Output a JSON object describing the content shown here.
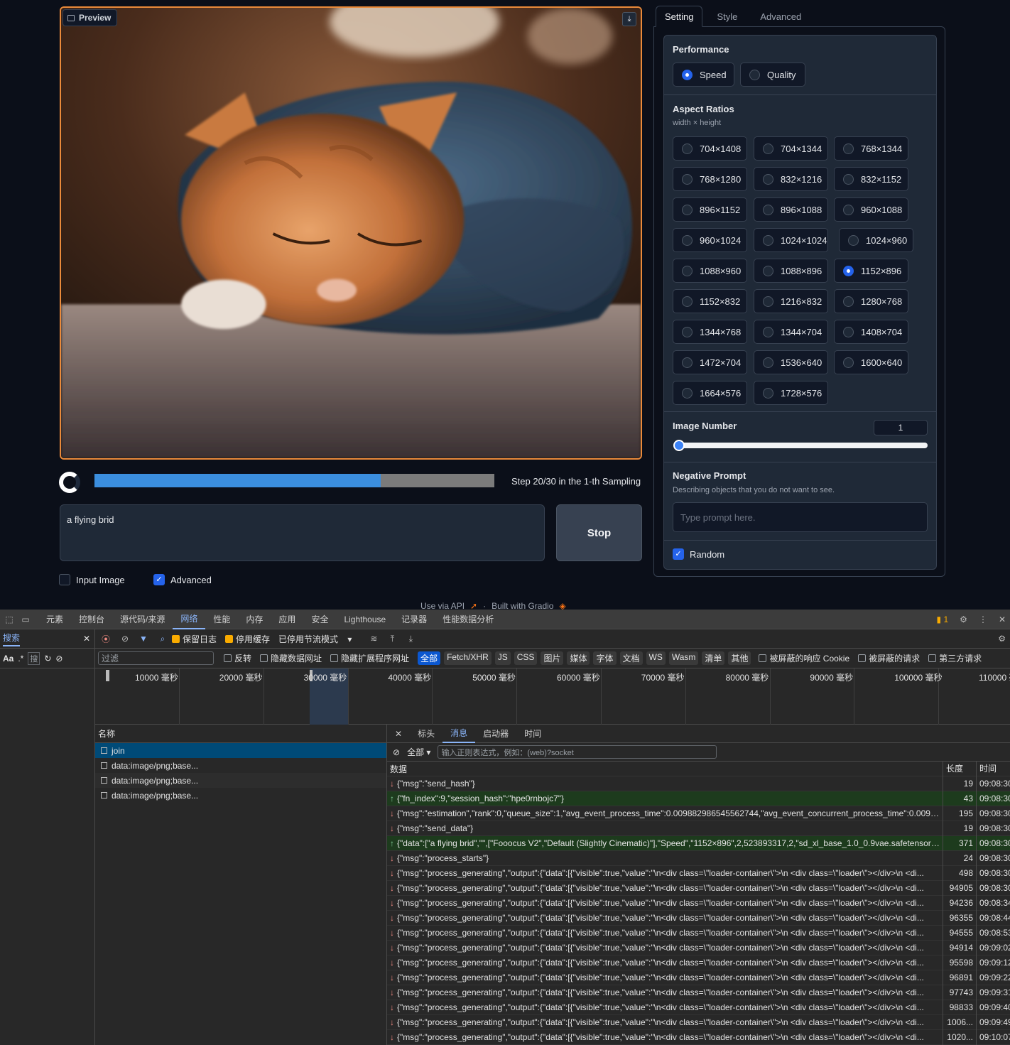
{
  "preview": {
    "label": "Preview"
  },
  "progress": {
    "fraction": 0.715,
    "step_text": "Step 20/30 in the 1-th Sampling"
  },
  "prompt": {
    "value": "a flying brid"
  },
  "stop_button": {
    "label": "Stop"
  },
  "checks": {
    "input_image": "Input Image",
    "advanced": "Advanced"
  },
  "footer": {
    "api": "Use via API",
    "sep": "·",
    "built": "Built with Gradio"
  },
  "tabs": [
    "Setting",
    "Style",
    "Advanced"
  ],
  "performance": {
    "title": "Performance",
    "options": [
      "Speed",
      "Quality"
    ],
    "selected": "Speed"
  },
  "aspect": {
    "title": "Aspect Ratios",
    "subtitle": "width × height",
    "options": [
      "704×1408",
      "704×1344",
      "768×1344",
      "768×1280",
      "832×1216",
      "832×1152",
      "896×1152",
      "896×1088",
      "960×1088",
      "960×1024",
      "1024×1024",
      "1024×960",
      "1088×960",
      "1088×896",
      "1152×896",
      "1152×832",
      "1216×832",
      "1280×768",
      "1344×768",
      "1344×704",
      "1408×704",
      "1472×704",
      "1536×640",
      "1600×640",
      "1664×576",
      "1728×576"
    ],
    "selected": "1152×896"
  },
  "image_number": {
    "title": "Image Number",
    "value": "1"
  },
  "negative": {
    "title": "Negative Prompt",
    "subtitle": "Describing objects that you do not want to see.",
    "placeholder": "Type prompt here."
  },
  "random": {
    "label": "Random"
  },
  "devtools": {
    "tabs": [
      "元素",
      "控制台",
      "源代码/来源",
      "网络",
      "性能",
      "内存",
      "应用",
      "安全",
      "Lighthouse",
      "记录器",
      "性能数据分析"
    ],
    "active_tab": "网络",
    "issues_count": "1",
    "search_label": "搜索",
    "aa": "Aa",
    "dot_star": ".*",
    "search_box": "搜",
    "toolbar": {
      "preserve_log": "保留日志",
      "disable_cache": "停用缓存",
      "throttle": "已停用节流模式"
    },
    "filter": {
      "placeholder": "过滤",
      "invert": "反转",
      "hide_data": "隐藏数据网址",
      "hide_ext": "隐藏扩展程序网址",
      "types": [
        "全部",
        "Fetch/XHR",
        "JS",
        "CSS",
        "图片",
        "媒体",
        "字体",
        "文档",
        "WS",
        "Wasm",
        "清单",
        "其他"
      ],
      "blocked_cookie": "被屏蔽的响应 Cookie",
      "blocked_req": "被屏蔽的请求",
      "third_party": "第三方请求"
    },
    "timeline": [
      "10000 毫秒",
      "20000 毫秒",
      "30000 毫秒",
      "40000 毫秒",
      "50000 毫秒",
      "60000 毫秒",
      "70000 毫秒",
      "80000 毫秒",
      "90000 毫秒",
      "100000 毫秒",
      "110000 毫秒"
    ],
    "list": {
      "header": "名称",
      "rows": [
        "join",
        "data:image/png;base...",
        "data:image/png;base...",
        "data:image/png;base..."
      ]
    },
    "detail_tabs": [
      "标头",
      "消息",
      "启动器",
      "时间"
    ],
    "detail_active": "消息",
    "msg_filter_all": "全部",
    "msg_filter_placeholder": "输入正则表达式，例如：(web)?socket",
    "msg_cols": {
      "data": "数据",
      "length": "长度",
      "time": "时间"
    },
    "messages": [
      {
        "dir": "down",
        "text": "{\"msg\":\"send_hash\"}",
        "len": "19",
        "time": "09:08:30."
      },
      {
        "dir": "up",
        "text": "{\"fn_index\":9,\"session_hash\":\"hpe0rnbojc7\"}",
        "len": "43",
        "time": "09:08:30."
      },
      {
        "dir": "down",
        "text": "{\"msg\":\"estimation\",\"rank\":0,\"queue_size\":1,\"avg_event_process_time\":0.009882986545562744,\"avg_event_concurrent_process_time\":0.0098829...",
        "len": "195",
        "time": "09:08:30."
      },
      {
        "dir": "down",
        "text": "{\"msg\":\"send_data\"}",
        "len": "19",
        "time": "09:08:30."
      },
      {
        "dir": "up",
        "text": "{\"data\":[\"a flying brid\",\"\",[\"Fooocus V2\",\"Default (Slightly Cinematic)\"],\"Speed\",\"1152×896\",2,523893317,2,\"sd_xl_base_1.0_0.9vae.safetensors\",\"...",
        "len": "371",
        "time": "09:08:30."
      },
      {
        "dir": "down",
        "text": "{\"msg\":\"process_starts\"}",
        "len": "24",
        "time": "09:08:30."
      },
      {
        "dir": "down",
        "text": "{\"msg\":\"process_generating\",\"output\":{\"data\":[{\"visible\":true,\"value\":\"\\n<div class=\\\"loader-container\\\">\\n <div class=\\\"loader\\\"></div>\\n <di...",
        "len": "498",
        "time": "09:08:30."
      },
      {
        "dir": "down",
        "text": "{\"msg\":\"process_generating\",\"output\":{\"data\":[{\"visible\":true,\"value\":\"\\n<div class=\\\"loader-container\\\">\\n <div class=\\\"loader\\\"></div>\\n <di...",
        "len": "94905",
        "time": "09:08:30."
      },
      {
        "dir": "down",
        "text": "{\"msg\":\"process_generating\",\"output\":{\"data\":[{\"visible\":true,\"value\":\"\\n<div class=\\\"loader-container\\\">\\n <div class=\\\"loader\\\"></div>\\n <di...",
        "len": "94236",
        "time": "09:08:34."
      },
      {
        "dir": "down",
        "text": "{\"msg\":\"process_generating\",\"output\":{\"data\":[{\"visible\":true,\"value\":\"\\n<div class=\\\"loader-container\\\">\\n <div class=\\\"loader\\\"></div>\\n <di...",
        "len": "96355",
        "time": "09:08:44."
      },
      {
        "dir": "down",
        "text": "{\"msg\":\"process_generating\",\"output\":{\"data\":[{\"visible\":true,\"value\":\"\\n<div class=\\\"loader-container\\\">\\n <div class=\\\"loader\\\"></div>\\n <di...",
        "len": "94555",
        "time": "09:08:53."
      },
      {
        "dir": "down",
        "text": "{\"msg\":\"process_generating\",\"output\":{\"data\":[{\"visible\":true,\"value\":\"\\n<div class=\\\"loader-container\\\">\\n <div class=\\\"loader\\\"></div>\\n <di...",
        "len": "94914",
        "time": "09:09:02."
      },
      {
        "dir": "down",
        "text": "{\"msg\":\"process_generating\",\"output\":{\"data\":[{\"visible\":true,\"value\":\"\\n<div class=\\\"loader-container\\\">\\n <div class=\\\"loader\\\"></div>\\n <di...",
        "len": "95598",
        "time": "09:09:12."
      },
      {
        "dir": "down",
        "text": "{\"msg\":\"process_generating\",\"output\":{\"data\":[{\"visible\":true,\"value\":\"\\n<div class=\\\"loader-container\\\">\\n <div class=\\\"loader\\\"></div>\\n <di...",
        "len": "96891",
        "time": "09:09:22."
      },
      {
        "dir": "down",
        "text": "{\"msg\":\"process_generating\",\"output\":{\"data\":[{\"visible\":true,\"value\":\"\\n<div class=\\\"loader-container\\\">\\n <div class=\\\"loader\\\"></div>\\n <di...",
        "len": "97743",
        "time": "09:09:31."
      },
      {
        "dir": "down",
        "text": "{\"msg\":\"process_generating\",\"output\":{\"data\":[{\"visible\":true,\"value\":\"\\n<div class=\\\"loader-container\\\">\\n <div class=\\\"loader\\\"></div>\\n <di...",
        "len": "98833",
        "time": "09:09:40."
      },
      {
        "dir": "down",
        "text": "{\"msg\":\"process_generating\",\"output\":{\"data\":[{\"visible\":true,\"value\":\"\\n<div class=\\\"loader-container\\\">\\n <div class=\\\"loader\\\"></div>\\n <di...",
        "len": "1006...",
        "time": "09:09:49."
      },
      {
        "dir": "down",
        "text": "{\"msg\":\"process_generating\",\"output\":{\"data\":[{\"visible\":true,\"value\":\"\\n<div class=\\\"loader-container\\\">\\n <div class=\\\"loader\\\"></div>\\n <di...",
        "len": "1020...",
        "time": "09:10:07."
      }
    ]
  }
}
